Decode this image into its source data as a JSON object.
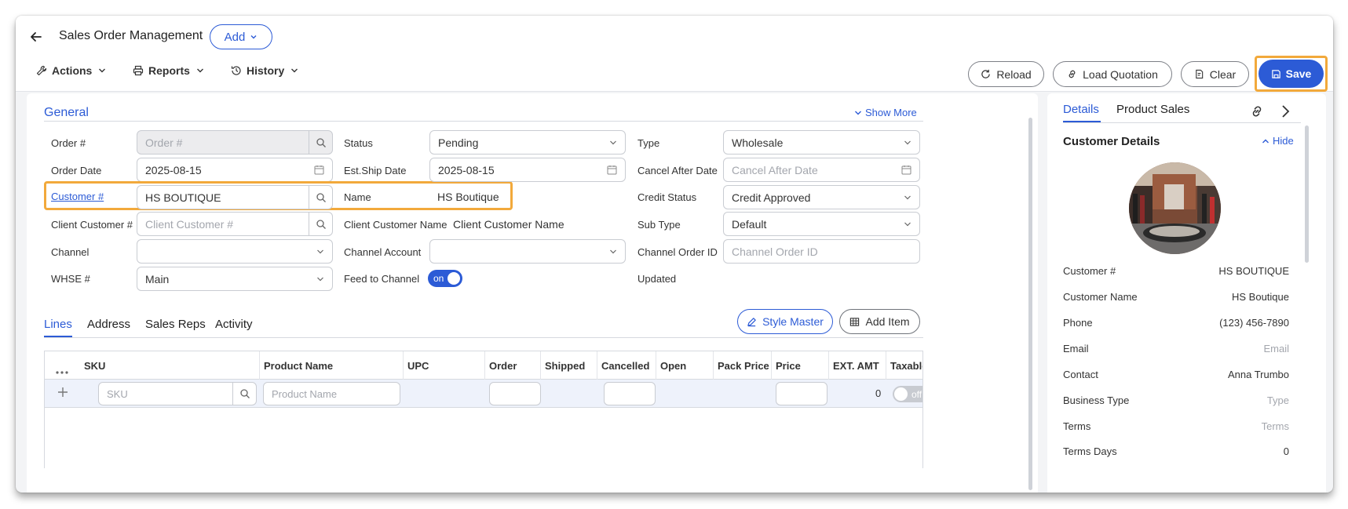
{
  "header": {
    "title": "Sales Order Management",
    "add_label": "Add",
    "menus": [
      "Actions",
      "Reports",
      "History"
    ],
    "buttons": {
      "reload": "Reload",
      "load_quotation": "Load Quotation",
      "clear": "Clear",
      "save": "Save"
    }
  },
  "general": {
    "title": "General",
    "show_more": "Show More",
    "col1": {
      "order_label": "Order #",
      "order_placeholder": "Order #",
      "order_date_label": "Order Date",
      "order_date_value": "2025-08-15",
      "customer_label": "Customer #",
      "customer_value": "HS BOUTIQUE",
      "client_customer_label": "Client Customer #",
      "client_customer_placeholder": "Client Customer #",
      "channel_label": "Channel",
      "channel_value": "",
      "whse_label": "WHSE #",
      "whse_value": "Main"
    },
    "col2": {
      "status_label": "Status",
      "status_value": "Pending",
      "est_ship_label": "Est.Ship Date",
      "est_ship_value": "2025-08-15",
      "name_label": "Name",
      "name_value": "HS Boutique",
      "client_customer_name_label": "Client Customer Name",
      "client_customer_name_placeholder": "Client Customer Name",
      "channel_account_label": "Channel Account",
      "channel_account_value": "",
      "feed_label": "Feed to Channel",
      "feed_value": "on"
    },
    "col3": {
      "type_label": "Type",
      "type_value": "Wholesale",
      "cancel_after_label": "Cancel After Date",
      "cancel_after_placeholder": "Cancel After Date",
      "credit_status_label": "Credit Status",
      "credit_status_value": "Credit Approved",
      "sub_type_label": "Sub Type",
      "sub_type_value": "Default",
      "channel_order_label": "Channel Order ID",
      "channel_order_placeholder": "Channel Order ID",
      "updated_label": "Updated"
    }
  },
  "lines": {
    "tabs": [
      "Lines",
      "Address",
      "Sales Reps",
      "Activity"
    ],
    "style_master": "Style Master",
    "add_item": "Add Item",
    "columns": [
      "SKU",
      "Product Name",
      "UPC",
      "Order",
      "Shipped",
      "Cancelled",
      "Open",
      "Pack Price",
      "Price",
      "EXT. AMT",
      "Taxable"
    ],
    "row": {
      "sku_placeholder": "SKU",
      "product_placeholder": "Product Name",
      "ext_amt": "0",
      "taxable": "off"
    }
  },
  "side": {
    "tabs": [
      "Details",
      "Product Sales"
    ],
    "title": "Customer Details",
    "hide": "Hide",
    "details": [
      {
        "label": "Customer #",
        "value": "HS BOUTIQUE",
        "placeholder": false
      },
      {
        "label": "Customer Name",
        "value": "HS Boutique",
        "placeholder": false
      },
      {
        "label": "Phone",
        "value": "(123) 456-7890",
        "placeholder": false
      },
      {
        "label": "Email",
        "value": "Email",
        "placeholder": true
      },
      {
        "label": "Contact",
        "value": "Anna Trumbo",
        "placeholder": false
      },
      {
        "label": "Business Type",
        "value": "Type",
        "placeholder": true
      },
      {
        "label": "Terms",
        "value": "Terms",
        "placeholder": true
      },
      {
        "label": "Terms Days",
        "value": "0",
        "placeholder": false
      }
    ]
  },
  "colors": {
    "accent": "#2c5bd6",
    "highlight": "#f2a93b"
  }
}
